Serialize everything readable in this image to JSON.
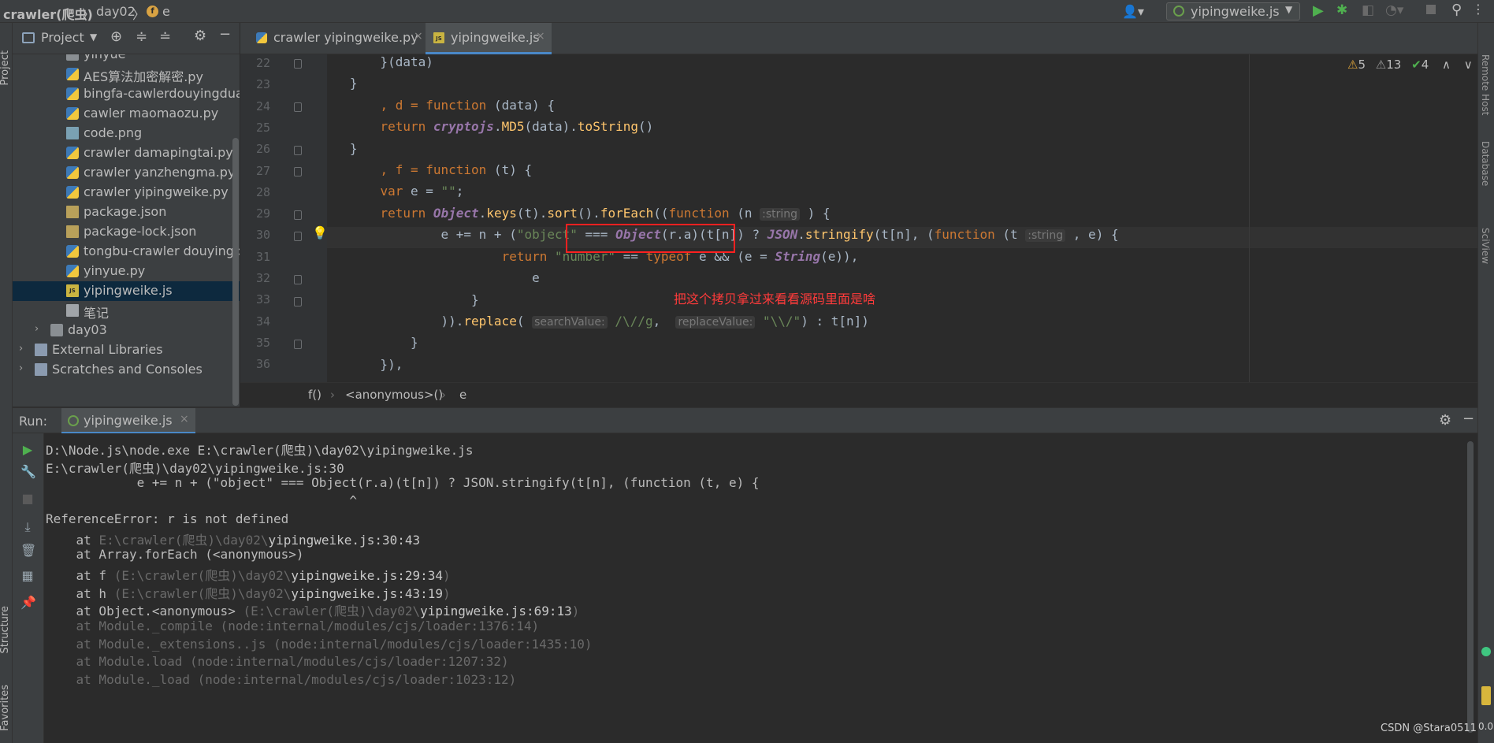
{
  "titlebar": {
    "project": "crawler(爬虫)",
    "folder": "day02",
    "symbol": "e",
    "run_config": "yipingweike.js"
  },
  "left_strip": {
    "project": "Project",
    "structure": "Structure",
    "favorites": "Favorites"
  },
  "right_strip": {
    "remote_host": "Remote Host",
    "database": "Database",
    "sciview": "SciView"
  },
  "project_panel": {
    "title": "Project",
    "items": [
      {
        "label": "yinyue",
        "icon": "folder-icon",
        "indent": 2
      },
      {
        "label": "AES算法加密解密.py",
        "icon": "python-file-icon",
        "indent": 2
      },
      {
        "label": "bingfa-cawlerdouyingduan",
        "icon": "python-file-icon",
        "indent": 2
      },
      {
        "label": "cawler maomaozu.py",
        "icon": "python-file-icon",
        "indent": 2
      },
      {
        "label": "code.png",
        "icon": "image-file-icon",
        "indent": 2
      },
      {
        "label": "crawler damapingtai.py",
        "icon": "python-file-icon",
        "indent": 2
      },
      {
        "label": "crawler yanzhengma.py",
        "icon": "python-file-icon",
        "indent": 2
      },
      {
        "label": "crawler yipingweike.py",
        "icon": "python-file-icon",
        "indent": 2
      },
      {
        "label": "package.json",
        "icon": "json-file-icon",
        "indent": 2
      },
      {
        "label": "package-lock.json",
        "icon": "json-file-icon",
        "indent": 2
      },
      {
        "label": "tongbu-crawler douyingdu",
        "icon": "python-file-icon",
        "indent": 2
      },
      {
        "label": "yinyue.py",
        "icon": "python-file-icon",
        "indent": 2
      },
      {
        "label": "yipingweike.js",
        "icon": "js-file-icon",
        "indent": 2,
        "selected": true
      },
      {
        "label": "笔记",
        "icon": "text-file-icon",
        "indent": 2
      },
      {
        "label": "day03",
        "icon": "folder-icon",
        "indent": 1,
        "arrow": "›"
      },
      {
        "label": "External Libraries",
        "icon": "library-icon",
        "indent": 0,
        "arrow": "›"
      },
      {
        "label": "Scratches and Consoles",
        "icon": "scratches-icon",
        "indent": 0,
        "arrow": "›"
      }
    ]
  },
  "tabs": [
    {
      "label": "crawler yipingweike.py",
      "active": false
    },
    {
      "label": "yipingweike.js",
      "active": true
    }
  ],
  "inspections": {
    "warnings": "5",
    "weak_warnings": "13",
    "typos": "4"
  },
  "editor": {
    "line_numbers": [
      "22",
      "23",
      "24",
      "25",
      "26",
      "27",
      "28",
      "29",
      "30",
      "31",
      "32",
      "33",
      "34",
      "35",
      "36"
    ],
    "hints": {
      "string1": ":string",
      "string2": ":string",
      "search": "searchValue:",
      "replace": "replaceValue:"
    }
  },
  "annotation": "把这个拷贝拿过来看看源码里面是啥",
  "code_breadcrumb": [
    "f()",
    "<anonymous>()",
    "e"
  ],
  "run_panel": {
    "label": "Run:",
    "tab": "yipingweike.js"
  },
  "console": [
    {
      "text": "D:\\Node.js\\node.exe E:\\crawler(爬虫)\\day02\\yipingweike.js",
      "style": "normal"
    },
    {
      "text": "E:\\crawler(爬虫)\\day02\\yipingweike.js:30",
      "style": "normal"
    },
    {
      "text": "            e += n + (\"object\" === Object(r.a)(t[n]) ? JSON.stringify(t[n], (function (t, e) {",
      "style": "normal"
    },
    {
      "text": "                                        ^",
      "style": "normal"
    },
    {
      "text": "ReferenceError: r is not defined",
      "style": "normal"
    },
    {
      "pre": "    at ",
      "dim": "E:\\crawler(爬虫)\\day02\\",
      "link": "yipingweike.js:30:43",
      "post": "",
      "style": "frame"
    },
    {
      "text": "    at Array.forEach (<anonymous>)",
      "style": "normal"
    },
    {
      "pre": "    at f ",
      "dim": "(E:\\crawler(爬虫)\\day02\\",
      "link": "yipingweike.js:29:34",
      "post": ")",
      "style": "frame"
    },
    {
      "pre": "    at h ",
      "dim": "(E:\\crawler(爬虫)\\day02\\",
      "link": "yipingweike.js:43:19",
      "post": ")",
      "style": "frame"
    },
    {
      "pre": "    at Object.<anonymous> ",
      "dim": "(E:\\crawler(爬虫)\\day02\\",
      "link": "yipingweike.js:69:13",
      "post": ")",
      "style": "frame"
    },
    {
      "text": "    at Module._compile (node:internal/modules/cjs/loader:1376:14)",
      "style": "dim"
    },
    {
      "text": "    at Module._extensions..js (node:internal/modules/cjs/loader:1435:10)",
      "style": "dim"
    },
    {
      "text": "    at Module.load (node:internal/modules/cjs/loader:1207:32)",
      "style": "dim"
    },
    {
      "text": "    at Module._load (node:internal/modules/cjs/loader:1023:12)",
      "style": "dim"
    }
  ],
  "watermark": "CSDN @Stara0511",
  "corner_text": "0.0"
}
